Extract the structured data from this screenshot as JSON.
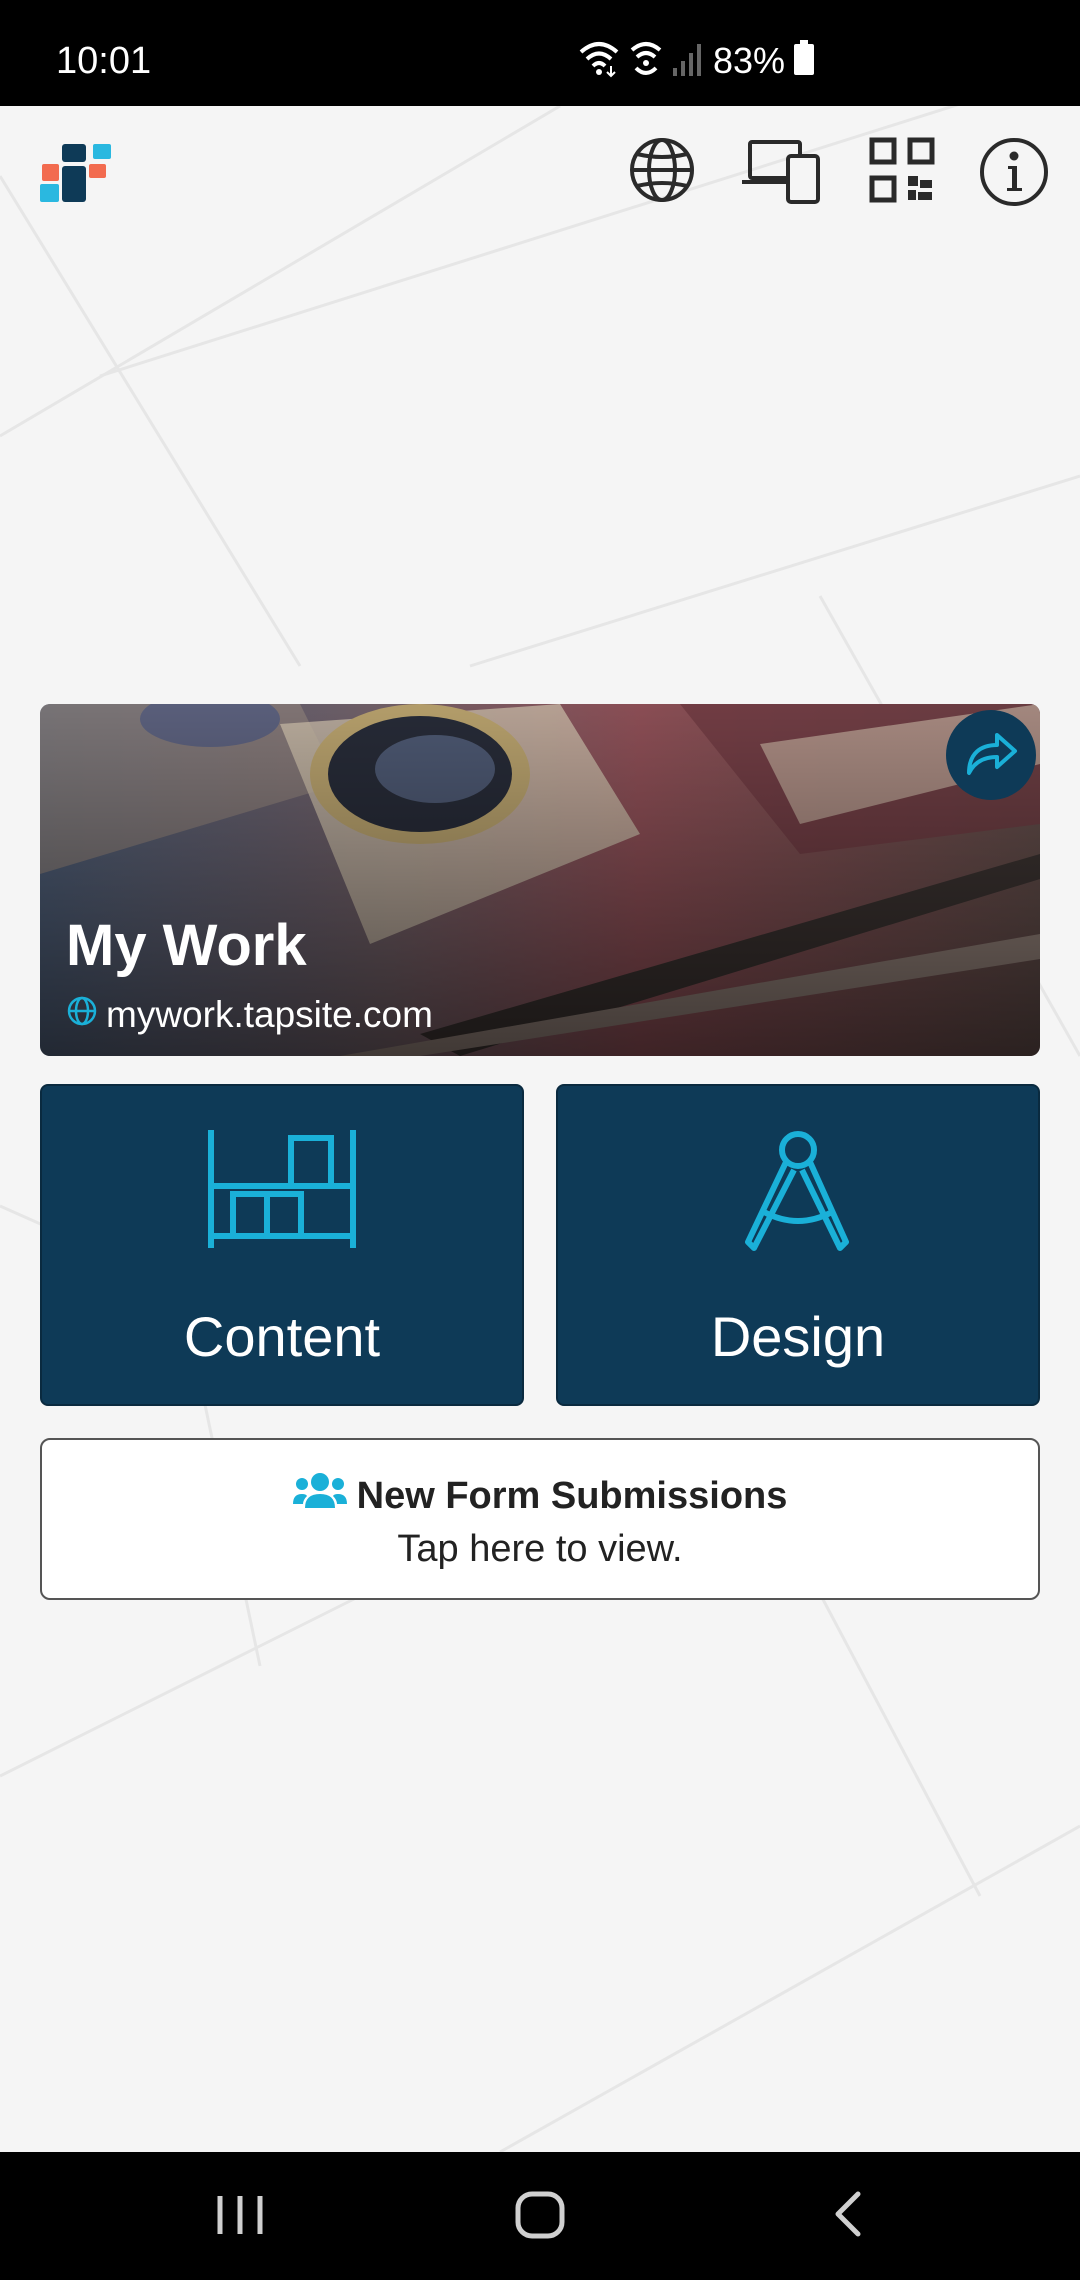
{
  "status_bar": {
    "time": "10:01",
    "battery": "83%",
    "icons": [
      "wifi-icon",
      "hotspot-icon",
      "signal-icon",
      "battery-icon"
    ]
  },
  "toolbar": {
    "icons": [
      "app-logo",
      "globe-icon",
      "devices-icon",
      "qr-code-icon",
      "info-icon"
    ]
  },
  "site_card": {
    "title": "My Work",
    "url": "mywork.tapsite.com",
    "share_icon": "share-icon"
  },
  "tiles": [
    {
      "label": "Content",
      "icon": "shelves-icon"
    },
    {
      "label": "Design",
      "icon": "compass-icon"
    }
  ],
  "notice": {
    "title": "New Form Submissions",
    "subtitle": "Tap here to view.",
    "icon": "users-icon"
  },
  "nav_bar": {
    "icons": [
      "recents-icon",
      "home-icon",
      "back-icon"
    ]
  },
  "colors": {
    "accent": "#1ab0d8",
    "tile_bg": "#0e3a57",
    "logo_orange": "#f26b4f",
    "logo_blue": "#2ab8e0",
    "logo_dark": "#0e3a57"
  }
}
